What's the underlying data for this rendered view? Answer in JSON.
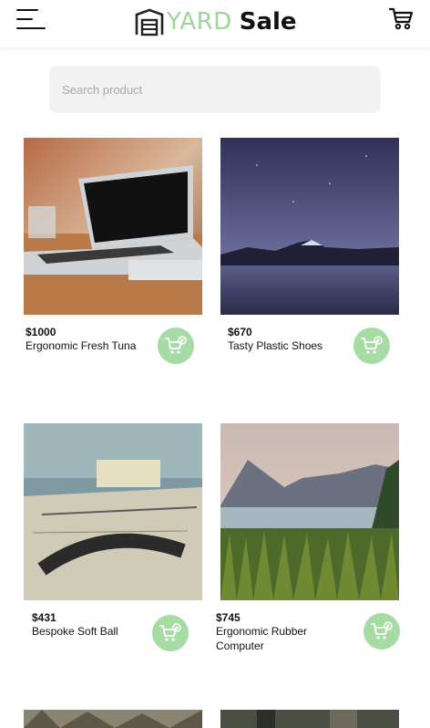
{
  "header": {
    "brand_yard": "YARD",
    "brand_sale": "Sale"
  },
  "search": {
    "placeholder": "Search product"
  },
  "colors": {
    "accent": "#a7dba4",
    "logo_green": "#9fd49a"
  },
  "products": [
    {
      "price": "$1000",
      "name": "Ergonomic Fresh Tuna",
      "image": "laptop-on-desk"
    },
    {
      "price": "$670",
      "name": "Tasty Plastic Shoes",
      "image": "night-lake-mountain"
    },
    {
      "price": "$431",
      "name": "Bespoke Soft Ball",
      "image": "map-with-protractor"
    },
    {
      "price": "$745",
      "name": "Ergonomic Rubber Computer",
      "image": "lake-with-grass"
    }
  ],
  "icons": {
    "menu": "hamburger-menu-icon",
    "cart": "cart-icon",
    "add_to_cart": "add-to-cart-icon"
  }
}
